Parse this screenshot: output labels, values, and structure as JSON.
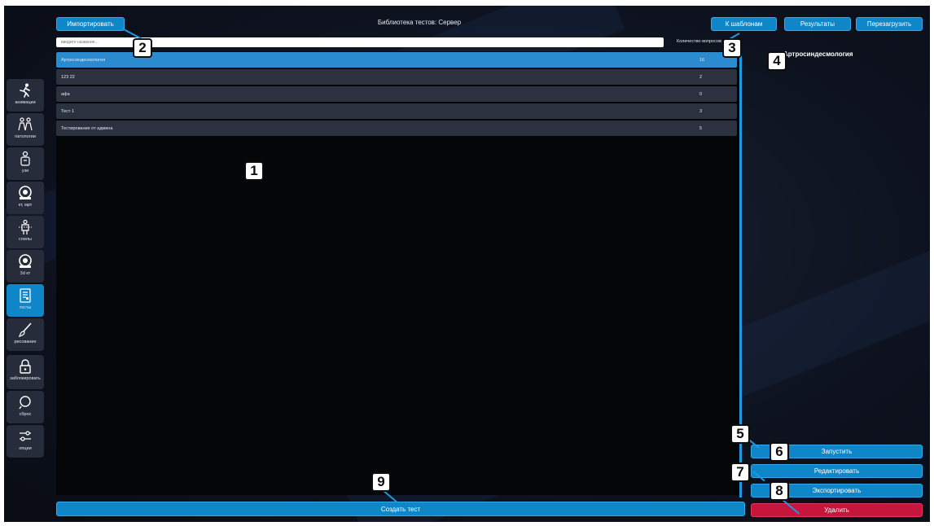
{
  "header": {
    "title": "Библиотека тестов: Сервер",
    "import_label": "Импортировать",
    "templates_label": "К шаблонам",
    "results_label": "Результаты",
    "reload_label": "Перезагрузить"
  },
  "search": {
    "placeholder": "введите название...",
    "count_header": "Количество вопросов"
  },
  "sidebar": {
    "items": [
      {
        "label": "анимации",
        "icon": "running-person-icon"
      },
      {
        "label": "патологии",
        "icon": "body-pair-icon"
      },
      {
        "label": "узи",
        "icon": "ultrasound-person-icon"
      },
      {
        "label": "кт, мрт",
        "icon": "ct-scanner-icon"
      },
      {
        "label": "спилы",
        "icon": "slice-body-icon"
      },
      {
        "label": "3d кт",
        "icon": "ct-scanner-icon"
      },
      {
        "label": "тесты",
        "icon": "test-document-icon"
      },
      {
        "label": "рисование",
        "icon": "brush-icon"
      },
      {
        "label": "заблокировать",
        "icon": "lock-icon"
      },
      {
        "label": "сброс",
        "icon": "reset-icon"
      },
      {
        "label": "опции",
        "icon": "sliders-icon"
      }
    ]
  },
  "tests": [
    {
      "name": "Артросиндесмология",
      "count": "16"
    },
    {
      "name": "123 22",
      "count": "2"
    },
    {
      "name": "афа",
      "count": "0"
    },
    {
      "name": "Тест 1",
      "count": "3"
    },
    {
      "name": "Тестирование от админа",
      "count": "5"
    }
  ],
  "detail": {
    "selected_title": "Артросиндесмология"
  },
  "actions": {
    "run_label": "Запустить",
    "edit_label": "Редактировать",
    "export_label": "Экспортировать",
    "delete_label": "Удалить",
    "create_label": "Создать тест"
  },
  "badges": [
    "1",
    "2",
    "3",
    "4",
    "5",
    "6",
    "7",
    "8",
    "9"
  ],
  "colors": {
    "accent": "#0e86c8",
    "danger": "#c7163c",
    "selected_row": "#2b8bd0",
    "row": "#2c3140",
    "background": "#0e1320"
  }
}
